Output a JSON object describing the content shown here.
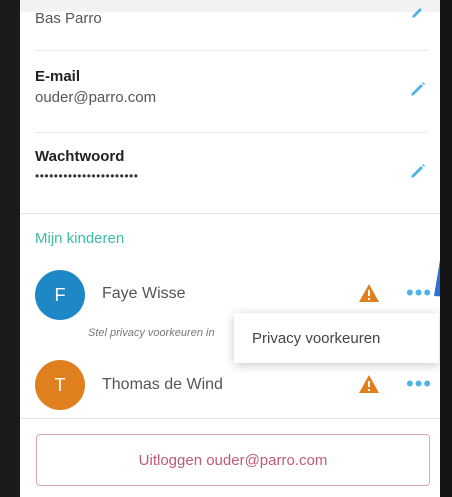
{
  "profile": {
    "name_value": "Bas Parro",
    "email_label": "E-mail",
    "email_value": "ouder@parro.com",
    "password_label": "Wachtwoord",
    "password_value": "••••••••••••••••••••••"
  },
  "children": {
    "section_title": "Mijn kinderen",
    "items": [
      {
        "initial": "F",
        "name": "Faye Wisse",
        "avatar_color": "#1e88c7"
      },
      {
        "initial": "T",
        "name": "Thomas de Wind",
        "avatar_color": "#e07f1e"
      }
    ],
    "privacy_hint": "Stel privacy voorkeuren in",
    "more_label": "•••"
  },
  "popup": {
    "item_label": "Privacy voorkeuren"
  },
  "logout": {
    "label": "Uitloggen ouder@parro.com"
  },
  "colors": {
    "accent": "#3cbba6",
    "pencil": "#4fb3e6",
    "warning": "#e07f1e",
    "logout_border": "#d7a7b3",
    "logout_text": "#c25a76"
  },
  "icons": [
    "pencil-icon",
    "warning-icon",
    "more-options-icon"
  ]
}
